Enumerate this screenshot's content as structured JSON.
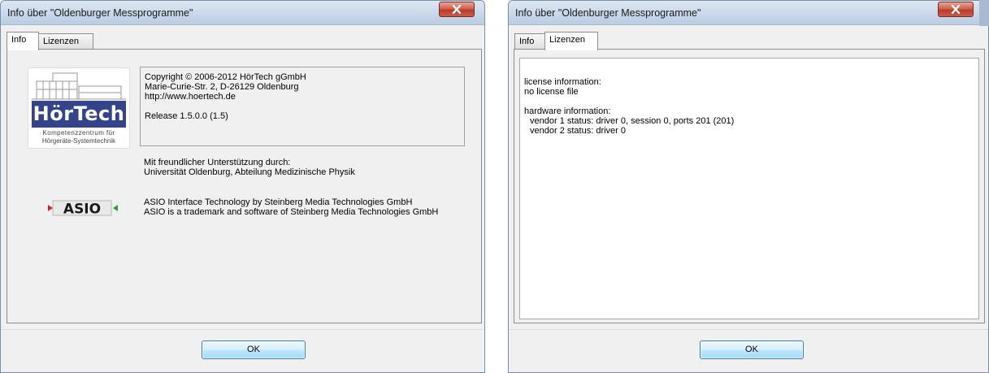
{
  "left_window": {
    "title": "Info über \"Oldenburger Messprogramme\"",
    "tabs": [
      {
        "label": "Info",
        "active": true
      },
      {
        "label": "Lizenzen",
        "active": false
      }
    ],
    "hortech_logo": {
      "brand": "HörTech",
      "line1": "Kompetenzzentrum für",
      "line2": "Hörgeräte-Systemtechnik"
    },
    "copyright": {
      "line1": "Copyright © 2006-2012 HörTech gGmbH",
      "line2": "Marie-Curie-Str. 2, D-26129 Oldenburg",
      "line3": "http://www.hoertech.de",
      "release": "Release 1.5.0.0 (1.5)"
    },
    "support": {
      "line1": "Mit freundlicher Unterstützung durch:",
      "line2": "Universität Oldenburg, Abteilung Medizinische Physik"
    },
    "asio_logo": {
      "text": "ASIO"
    },
    "asio": {
      "line1": "ASIO Interface Technology by Steinberg Media Technologies GmbH",
      "line2": "ASIO is a trademark and software of Steinberg Media Technologies GmbH"
    },
    "ok_label": "OK"
  },
  "right_window": {
    "title": "Info über \"Oldenburger Messprogramme\"",
    "tabs": [
      {
        "label": "Info",
        "active": false
      },
      {
        "label": "Lizenzen",
        "active": true
      }
    ],
    "license": {
      "heading": "license information:",
      "status": "no license file",
      "hw_heading": "hardware information:",
      "vendor1": "vendor 1 status: driver 0, session 0, ports 201 (201)",
      "vendor2": "vendor 2 status: driver 0"
    },
    "ok_label": "OK"
  },
  "colors": {
    "titlebar": "#c9d8ea",
    "close_button": "#c94f3c",
    "hortech_blue": "#33448a",
    "ok_button": "#bee6fd",
    "asio_green": "#2f9b3a",
    "asio_red": "#d0282a"
  },
  "icons": [
    "close-icon"
  ]
}
